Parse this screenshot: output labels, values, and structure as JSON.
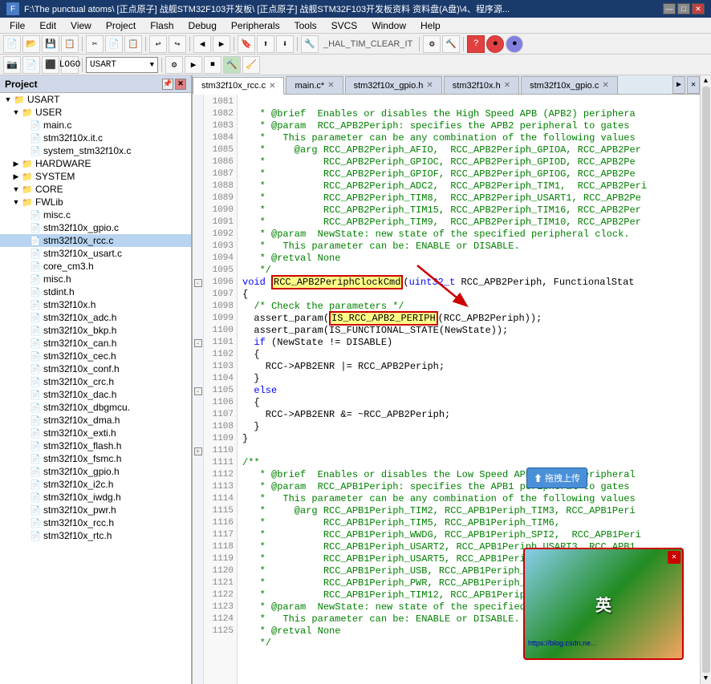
{
  "titlebar": {
    "title": "F:\\The punctual atoms\\ [正点原子] 战舰STM32F103开发板\\ [正点原子] 战舰STM32F103开发板资料 资料盘(A盘)\\4、程序源...",
    "icon": "F",
    "minimize": "—",
    "maximize": "□",
    "close": "✕"
  },
  "menubar": {
    "items": [
      "File",
      "Edit",
      "View",
      "Project",
      "Flash",
      "Debug",
      "Peripherals",
      "Tools",
      "SVCS",
      "Window",
      "Help"
    ]
  },
  "toolbar1": {
    "combo_value": "USART"
  },
  "project": {
    "title": "Project",
    "items": [
      {
        "label": "USART",
        "level": 0,
        "type": "folder",
        "expanded": true
      },
      {
        "label": "USER",
        "level": 1,
        "type": "folder",
        "expanded": true
      },
      {
        "label": "main.c",
        "level": 2,
        "type": "file"
      },
      {
        "label": "stm32f10x.it.c",
        "level": 2,
        "type": "file"
      },
      {
        "label": "system_stm32f10x.c",
        "level": 2,
        "type": "file"
      },
      {
        "label": "HARDWARE",
        "level": 1,
        "type": "folder",
        "expanded": false
      },
      {
        "label": "SYSTEM",
        "level": 1,
        "type": "folder",
        "expanded": false
      },
      {
        "label": "CORE",
        "level": 1,
        "type": "folder",
        "expanded": true
      },
      {
        "label": "FWLib",
        "level": 1,
        "type": "folder",
        "expanded": true
      },
      {
        "label": "misc.c",
        "level": 2,
        "type": "file"
      },
      {
        "label": "stm32f10x_gpio.c",
        "level": 2,
        "type": "file"
      },
      {
        "label": "stm32f10x_rcc.c",
        "level": 2,
        "type": "file",
        "selected": true
      },
      {
        "label": "stm32f10x_usart.c",
        "level": 2,
        "type": "file"
      },
      {
        "label": "core_cm3.h",
        "level": 2,
        "type": "file"
      },
      {
        "label": "misc.h",
        "level": 2,
        "type": "file"
      },
      {
        "label": "stdint.h",
        "level": 2,
        "type": "file"
      },
      {
        "label": "stm32f10x.h",
        "level": 2,
        "type": "file"
      },
      {
        "label": "stm32f10x_adc.h",
        "level": 2,
        "type": "file"
      },
      {
        "label": "stm32f10x_bkp.h",
        "level": 2,
        "type": "file"
      },
      {
        "label": "stm32f10x_can.h",
        "level": 2,
        "type": "file"
      },
      {
        "label": "stm32f10x_cec.h",
        "level": 2,
        "type": "file"
      },
      {
        "label": "stm32f10x_conf.h",
        "level": 2,
        "type": "file"
      },
      {
        "label": "stm32f10x_crc.h",
        "level": 2,
        "type": "file"
      },
      {
        "label": "stm32f10x_dac.h",
        "level": 2,
        "type": "file"
      },
      {
        "label": "stm32f10x_dbgmcu.",
        "level": 2,
        "type": "file"
      },
      {
        "label": "stm32f10x_dma.h",
        "level": 2,
        "type": "file"
      },
      {
        "label": "stm32f10x_exti.h",
        "level": 2,
        "type": "file"
      },
      {
        "label": "stm32f10x_flash.h",
        "level": 2,
        "type": "file"
      },
      {
        "label": "stm32f10x_fsmc.h",
        "level": 2,
        "type": "file"
      },
      {
        "label": "stm32f10x_gpio.h",
        "level": 2,
        "type": "file"
      },
      {
        "label": "stm32f10x_i2c.h",
        "level": 2,
        "type": "file"
      },
      {
        "label": "stm32f10x_iwdg.h",
        "level": 2,
        "type": "file"
      },
      {
        "label": "stm32f10x_pwr.h",
        "level": 2,
        "type": "file"
      },
      {
        "label": "stm32f10x_rcc.h",
        "level": 2,
        "type": "file"
      },
      {
        "label": "stm32f10x_rtc.h",
        "level": 2,
        "type": "file"
      }
    ]
  },
  "tabs": [
    {
      "label": "stm32f10x_rcc.c",
      "active": true
    },
    {
      "label": "main.c*"
    },
    {
      "label": "stm32f10x_gpio.h"
    },
    {
      "label": "stm32f10x.h"
    },
    {
      "label": "stm32f10x_gpio.c"
    }
  ],
  "code": {
    "lines": [
      {
        "num": "1081",
        "text": "   * @brief  Enables or disables the High Speed APB (APB2) periphera"
      },
      {
        "num": "1082",
        "text": "   * @param  RCC_APB2Periph: specifies the APB2 peripheral to gates"
      },
      {
        "num": "1083",
        "text": "   *   This parameter can be any combination of the following values"
      },
      {
        "num": "1084",
        "text": "   *     @arg RCC_APB2Periph_AFIO,  RCC_APB2Periph_GPIOA, RCC_APB2Per"
      },
      {
        "num": "1085",
        "text": "   *          RCC_APB2Periph_GPIOC, RCC_APB2Periph_GPIOD, RCC_APB2Pe"
      },
      {
        "num": "1086",
        "text": "   *          RCC_APB2Periph_GPIOF, RCC_APB2Periph_GPIOG, RCC_APB2Pe"
      },
      {
        "num": "1087",
        "text": "   *          RCC_APB2Periph_ADC2,  RCC_APB2Periph_TIM1,  RCC_APB2Peri"
      },
      {
        "num": "1088",
        "text": "   *          RCC_APB2Periph_TIM8,  RCC_APB2Periph_USART1, RCC_APB2Pe"
      },
      {
        "num": "1089",
        "text": "   *          RCC_APB2Periph_TIM15, RCC_APB2Periph_TIM16, RCC_APB2Per"
      },
      {
        "num": "1090",
        "text": "   *          RCC_APB2Periph_TIM9,  RCC_APB2Periph_TIM10, RCC_APB2Per"
      },
      {
        "num": "1091",
        "text": "   * @param  NewState: new state of the specified peripheral clock."
      },
      {
        "num": "1092",
        "text": "   *   This parameter can be: ENABLE or DISABLE."
      },
      {
        "num": "1093",
        "text": "   * @retval None"
      },
      {
        "num": "1094",
        "text": "   */"
      },
      {
        "num": "1095",
        "text": "void RCC_APB2PeriphClockCmd(uint32_t RCC_APB2Periph, FunctionalStat"
      },
      {
        "num": "1096",
        "text": "{"
      },
      {
        "num": "1097",
        "text": "  /* Check the parameters */"
      },
      {
        "num": "1098",
        "text": "  assert_param(IS_RCC_APB2_PERIPH(RCC_APB2Periph));"
      },
      {
        "num": "1099",
        "text": "  assert_param(IS_FUNCTIONAL_STATE(NewState));"
      },
      {
        "num": "1100",
        "text": "  if (NewState != DISABLE)"
      },
      {
        "num": "1101",
        "text": "  {"
      },
      {
        "num": "1102",
        "text": "    RCC->APB2ENR |= RCC_APB2Periph;"
      },
      {
        "num": "1103",
        "text": "  }"
      },
      {
        "num": "1104",
        "text": "  else"
      },
      {
        "num": "1105",
        "text": "  {"
      },
      {
        "num": "1106",
        "text": "    RCC->APB2ENR &= ~RCC_APB2Periph;"
      },
      {
        "num": "1107",
        "text": "  }"
      },
      {
        "num": "1108",
        "text": "}"
      },
      {
        "num": "1109",
        "text": ""
      },
      {
        "num": "1110",
        "text": "/**"
      },
      {
        "num": "1111",
        "text": "   * @brief  Enables or disables the Low Speed APB (APB1) peripheral"
      },
      {
        "num": "1112",
        "text": "   * @param  RCC_APB1Periph: specifies the APB1 peripheral to gates"
      },
      {
        "num": "1113",
        "text": "   *   This parameter can be any combination of the following values"
      },
      {
        "num": "1114",
        "text": "   *     @arg RCC_APB1Periph_TIM2, RCC_APB1Periph_TIM3, RCC_APB1Peri"
      },
      {
        "num": "1115",
        "text": "   *          RCC_APB1Periph_TIM5, RCC_APB1Periph_TIM6, [拖拽上传]"
      },
      {
        "num": "1116",
        "text": "   *          RCC_APB1Periph_WWDG, RCC_APB1Periph_SPI2,  RCC_APB1Peri"
      },
      {
        "num": "1117",
        "text": "   *          RCC_APB1Periph_USART2, RCC_APB1Periph_USART3, RCC_APB1"
      },
      {
        "num": "1118",
        "text": "   *          RCC_APB1Periph_USART5, RCC_APB1Periph_I2C1,  RCC_APB1Pe"
      },
      {
        "num": "1119",
        "text": "   *          RCC_APB1Periph_USB, RCC_APB1Periph_CAN1, R"
      },
      {
        "num": "1120",
        "text": "   *          RCC_APB1Periph_PWR, RCC_APB1Periph_DAC, RC"
      },
      {
        "num": "1121",
        "text": "   *          RCC_APB1Periph_TIM12, RCC_APB1Periph_TIM13"
      },
      {
        "num": "1122",
        "text": "   * @param  NewState: new state of the specified periph"
      },
      {
        "num": "1123",
        "text": "   *   This parameter can be: ENABLE or DISABLE."
      },
      {
        "num": "1124",
        "text": "   * @retval None"
      },
      {
        "num": "1125",
        "text": "   */"
      }
    ]
  },
  "popup": {
    "brand": "英",
    "link": "https://blog.csdn.ne...",
    "sub_text": "拖拽上传"
  }
}
